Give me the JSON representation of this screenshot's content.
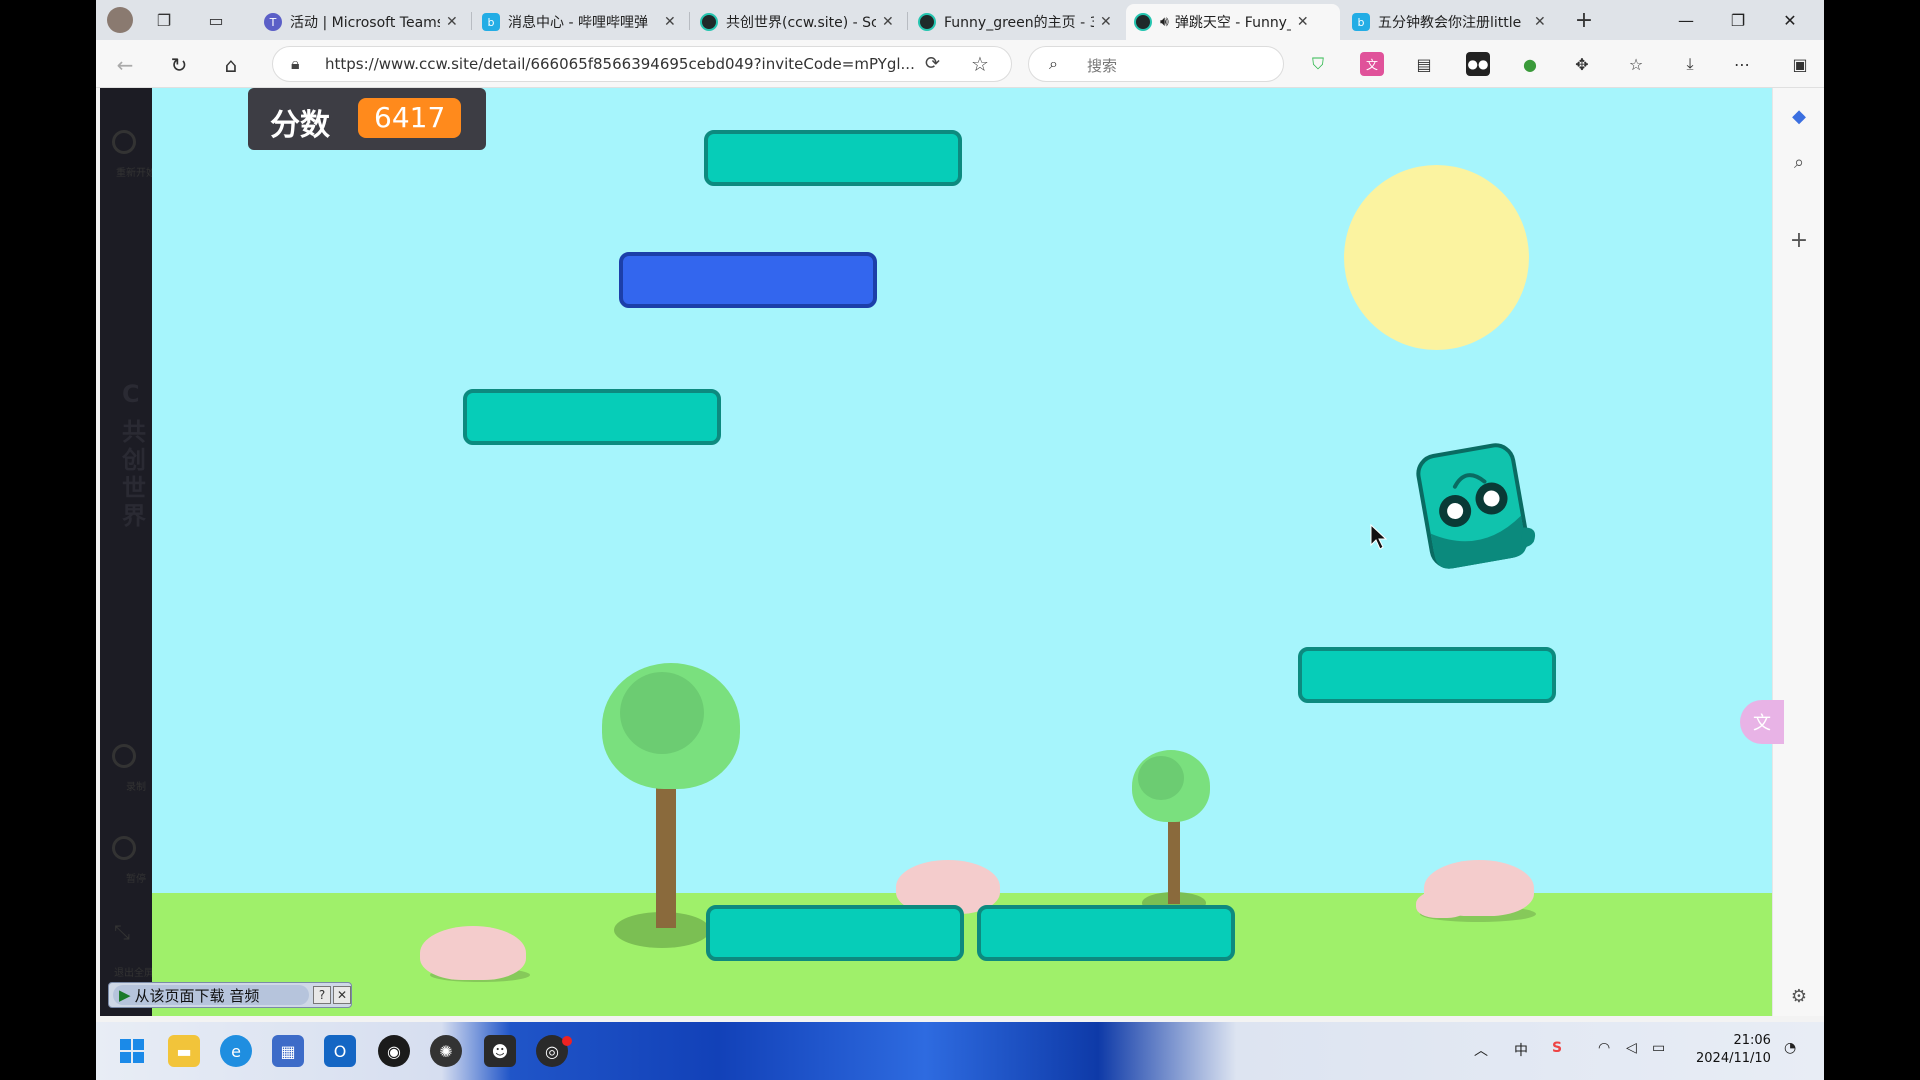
{
  "browser": {
    "tabs": [
      {
        "label": "活动 | Microsoft Teams",
        "icon": "teams-icon",
        "active": false
      },
      {
        "label": "消息中心 - 哔哩哔哩弹",
        "icon": "bilibili-icon",
        "active": false
      },
      {
        "label": "共创世界(ccw.site) - Sc",
        "icon": "ccw-icon",
        "active": false
      },
      {
        "label": "Funny_green的主页 - 3",
        "icon": "ccw-icon",
        "active": false
      },
      {
        "label": "弹跳天空 - Funny_",
        "icon": "ccw-icon",
        "active": true
      },
      {
        "label": "五分钟教会你注册little",
        "icon": "bilibili-icon",
        "active": false
      }
    ],
    "url": "https://www.ccw.site/detail/666065f8566394695cebd049?inviteCode=mPYgl...",
    "search_placeholder": "搜索"
  },
  "page": {
    "left_panel": {
      "restart_label": "重新开始",
      "brand_text": [
        "共",
        "创",
        "世",
        "界"
      ],
      "record_label": "录制",
      "pause_label": "暂停",
      "exit_label": "退出全屏"
    }
  },
  "game": {
    "title": "弹跳天空",
    "score_label": "分数",
    "score_value": "6417",
    "colors": {
      "sky": "#a6f5fc",
      "ground": "#9ff06a",
      "sun": "#fbf3a0",
      "platform": "#06cdb8",
      "platform_blue": "#3366ee",
      "score_badge": "#ff8a1c",
      "player": "#10c3ad"
    }
  },
  "download_bar": {
    "label": "从该页面下载 音频",
    "help": "?",
    "close": "✕"
  },
  "taskbar": {
    "time": "21:06",
    "date": "2024/11/10",
    "ime": "中"
  }
}
